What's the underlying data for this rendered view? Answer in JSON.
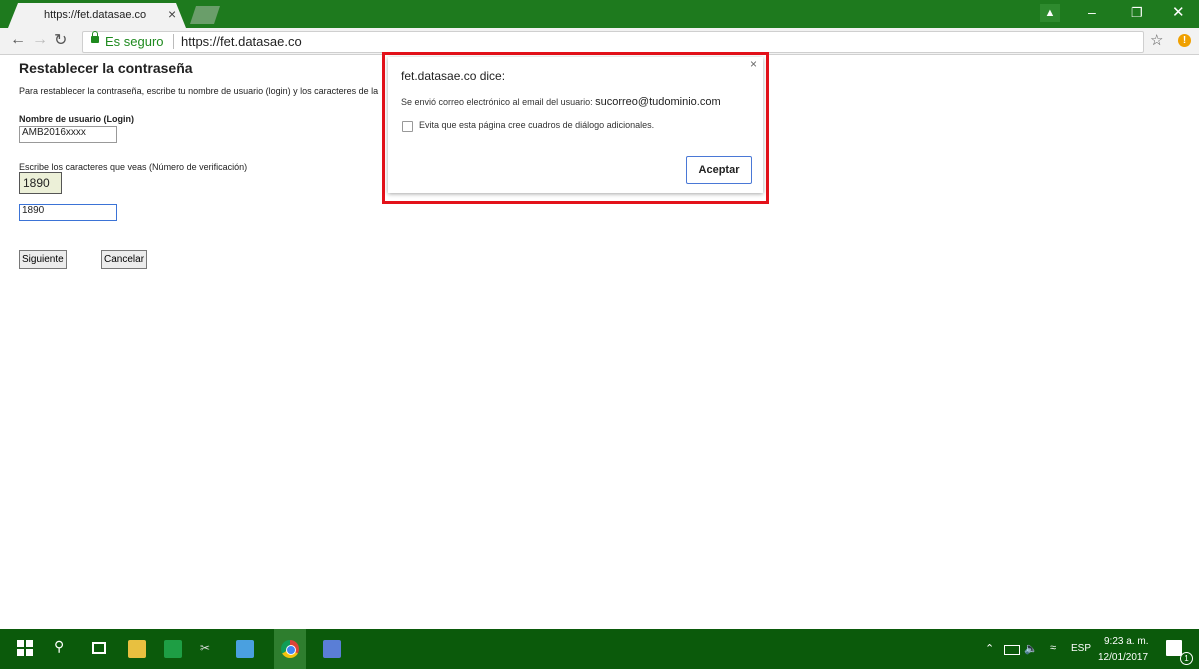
{
  "browser": {
    "tab_title": "https://fet.datasae.co",
    "tab_close": "×",
    "secure_label": "Es seguro",
    "url": "https://fet.datasae.co",
    "theme_color": "#1e7a1e"
  },
  "page": {
    "title": "Restablecer la contraseña",
    "instructions": "Para restablecer la contraseña, escribe tu nombre de usuario (login) y los caracteres de la",
    "login_label": "Nombre de usuario (Login)",
    "login_value": "AMB2016xxxx",
    "captcha_label": "Escribe los caracteres que veas (Número de verificación)",
    "captcha_code": "1890",
    "verification_value": "1890",
    "next_button": "Siguiente",
    "cancel_button": "Cancelar"
  },
  "dialog": {
    "title": "fet.datasae.co dice:",
    "message": "Se envió correo electrónico al email del usuario: ",
    "email": "sucorreo@tudominio.com",
    "checkbox_label": "Evita que esta página cree cuadros de diálogo adicionales.",
    "ok_button": "Aceptar",
    "close": "×",
    "highlight_color": "#e3111a"
  },
  "taskbar": {
    "language": "ESP",
    "time": "9:23 a. m.",
    "date": "12/01/2017",
    "notification_count": "1"
  }
}
